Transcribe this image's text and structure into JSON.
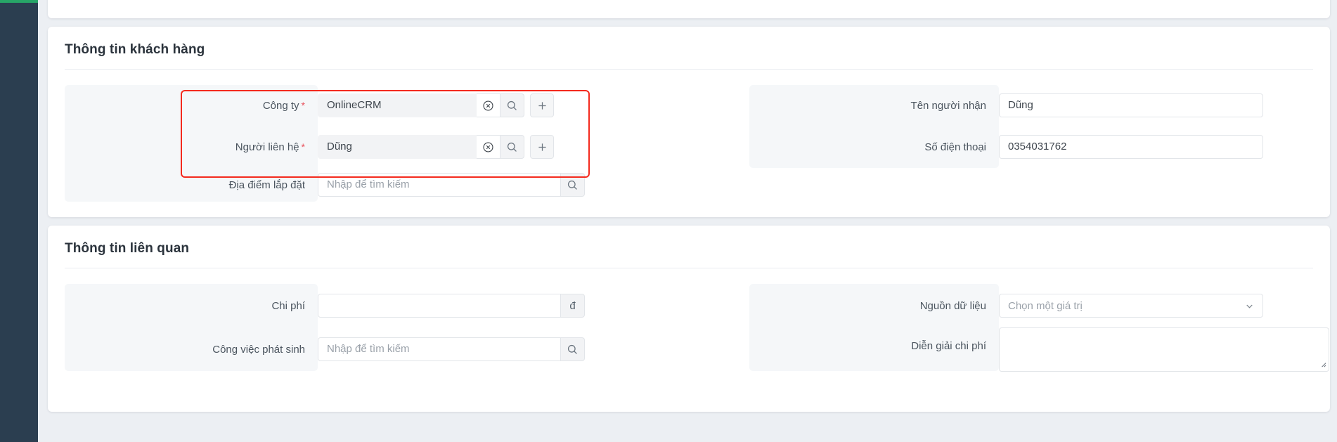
{
  "app": {
    "rail_accent_color": "#27a567",
    "rail_color": "#2b3e50",
    "highlight_color": "#f42a1e"
  },
  "sections": [
    {
      "title": "Thông tin khách hàng",
      "left_fields": [
        {
          "label": "Công ty",
          "required": true,
          "type": "lookup",
          "value": "OnlineCRM",
          "placeholder": "",
          "buttons": [
            "clear-circle-x-icon",
            "search-icon",
            "plus-icon"
          ]
        },
        {
          "label": "Người liên hệ",
          "required": true,
          "type": "lookup",
          "value": "Dũng",
          "placeholder": "",
          "buttons": [
            "clear-circle-x-icon",
            "search-icon",
            "plus-icon"
          ]
        },
        {
          "label": "Địa điểm lắp đặt",
          "required": false,
          "type": "search",
          "value": "",
          "placeholder": "Nhập để tìm kiếm",
          "buttons": [
            "search-icon"
          ]
        }
      ],
      "right_fields": [
        {
          "label": "Tên người nhận",
          "required": false,
          "type": "text",
          "value": "Dũng",
          "placeholder": ""
        },
        {
          "label": "Số điện thoại",
          "required": false,
          "type": "text",
          "value": "0354031762",
          "placeholder": ""
        }
      ]
    },
    {
      "title": "Thông tin liên quan",
      "left_fields": [
        {
          "label": "Chi phí",
          "required": false,
          "type": "currency",
          "value": "",
          "placeholder": "",
          "suffix": "đ"
        },
        {
          "label": "Công việc phát sinh",
          "required": false,
          "type": "search",
          "value": "",
          "placeholder": "Nhập để tìm kiếm",
          "buttons": [
            "search-icon"
          ]
        }
      ],
      "right_fields": [
        {
          "label": "Nguồn dữ liệu",
          "required": false,
          "type": "select",
          "value": "Chọn một giá trị",
          "placeholder": ""
        },
        {
          "label": "Diễn giải chi phí",
          "required": false,
          "type": "textarea",
          "value": "",
          "placeholder": ""
        }
      ]
    }
  ]
}
